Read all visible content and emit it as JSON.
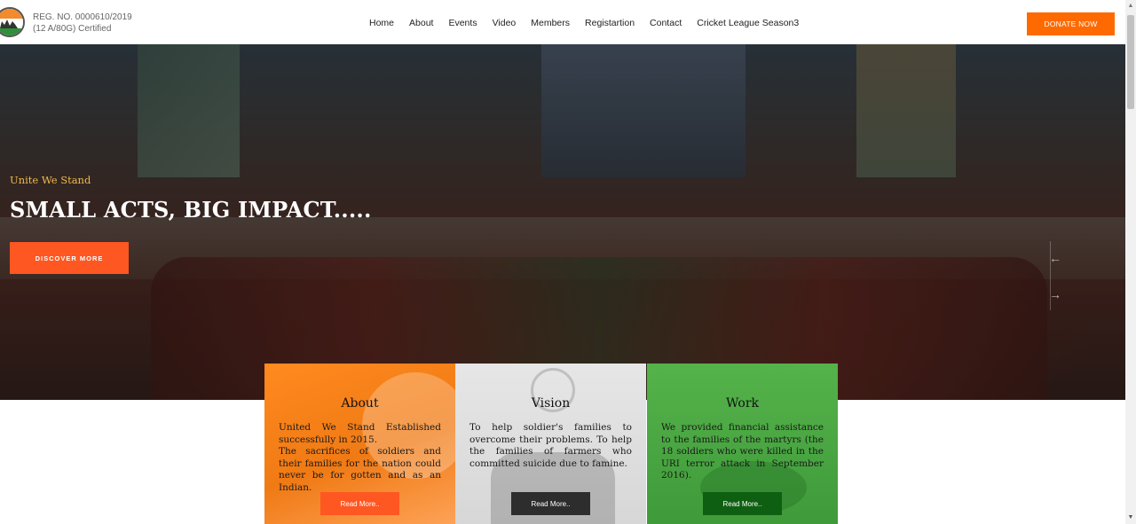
{
  "header": {
    "reg_line1": "REG. NO. 0000610/2019",
    "reg_line2": "(12 A/80G) Certified",
    "nav": [
      "Home",
      "About",
      "Events",
      "Video",
      "Members",
      "Registartion",
      "Contact",
      "Cricket League Season3"
    ],
    "donate_label": "DONATE NOW"
  },
  "hero": {
    "tagline": "Unite We Stand",
    "title": "SMALL ACTS, BIG IMPACT.....",
    "button_label": "DISCOVER MORE",
    "prev_arrow": "←",
    "next_arrow": "→"
  },
  "cards": [
    {
      "title": "About",
      "lines": [
        "United We Stand Established successfully in 2015.",
        "The sacrifices of soldiers and their families for the nation could never be for gotten and as an Indian."
      ],
      "button_label": "Read More..",
      "accent": "#ff5722"
    },
    {
      "title": "Vision",
      "lines": [
        "To help soldier's families to overcome their problems. To help the families of farmers who committed suicide due to famine."
      ],
      "button_label": "Read More..",
      "accent": "#2d2d2d"
    },
    {
      "title": "Work",
      "lines": [
        "We provided financial assistance to the families of the martyrs (the 18 soldiers who were killed in the URI terror attack in September 2016)."
      ],
      "button_label": "Read More..",
      "accent": "#0f5f12"
    }
  ],
  "colors": {
    "brand_orange": "#ff6a00",
    "tagline": "#f2b84b"
  }
}
